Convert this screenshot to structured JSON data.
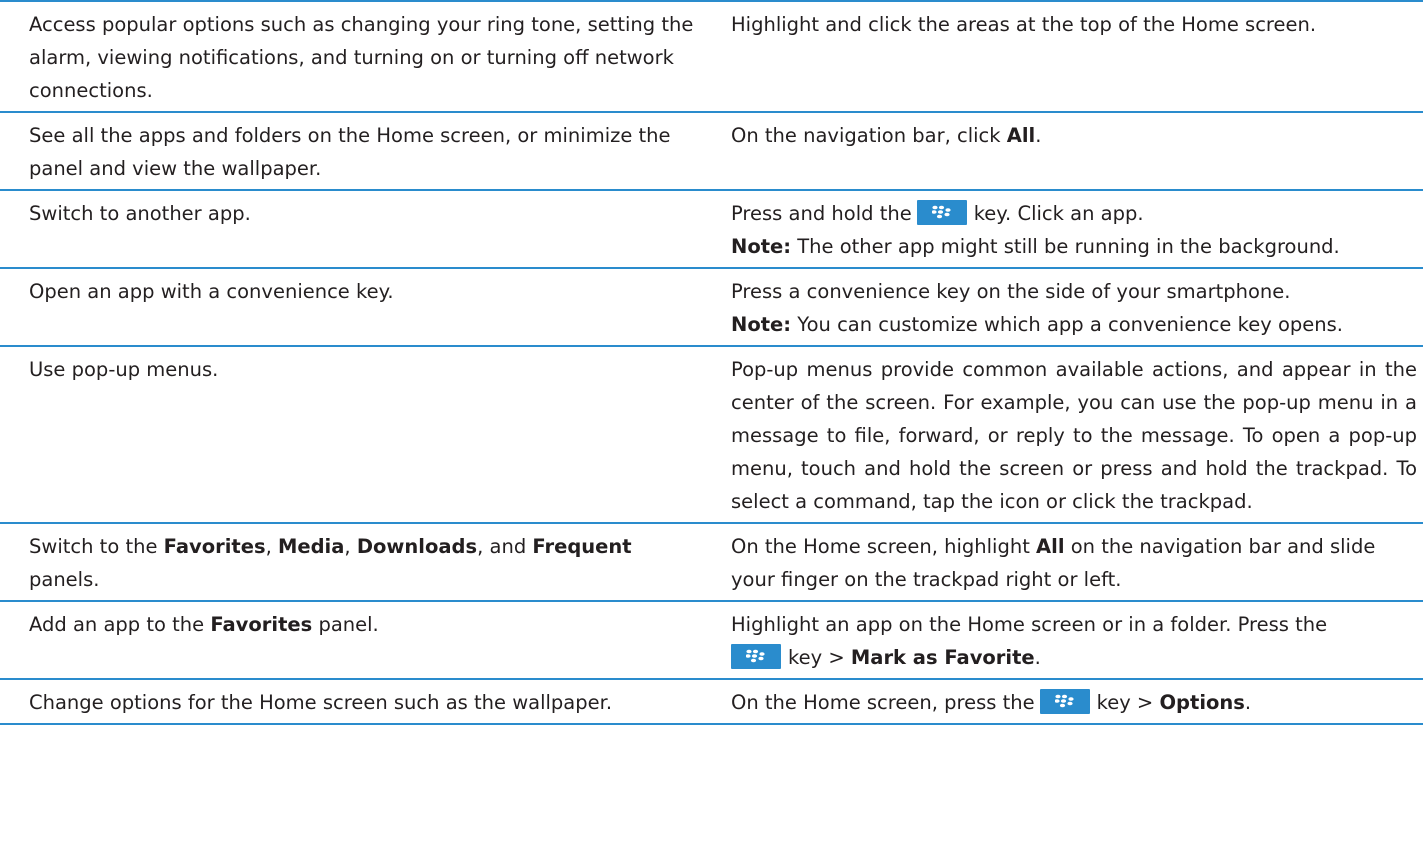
{
  "rows": [
    {
      "action": "Access popular options such as changing your ring tone, setting the alarm, viewing notifications, and turning on or turning off network connections.",
      "how": "Highlight and click the areas at the top of the Home screen."
    },
    {
      "action": "See all the apps and folders on the Home screen, or minimize the panel and view the wallpaper.",
      "how_pre": "On the navigation bar, click ",
      "how_bold": "All",
      "how_post": "."
    },
    {
      "action": "Switch to another app.",
      "how_pre": "Press and hold the",
      "how_post": "key. Click an app.",
      "note_label": "Note:",
      "note_text": " The other app might still be running in the background."
    },
    {
      "action": "Open an app with a convenience key.",
      "how": "Press a convenience key on the side of your smartphone.",
      "note_label": "Note:",
      "note_text": " You can customize which app a convenience key opens."
    },
    {
      "action": "Use pop-up menus.",
      "how": "Pop-up menus provide common available actions, and appear in the center of the screen. For example, you can use the pop-up menu in a message to file, forward, or reply to the message. To open a pop-up menu, touch and hold the screen or press and hold the trackpad. To select a command, tap the icon or click the trackpad."
    },
    {
      "action_pre": "Switch to the ",
      "action_b1": "Favorites",
      "action_s1": ", ",
      "action_b2": "Media",
      "action_s2": ", ",
      "action_b3": "Downloads",
      "action_s3": ", and ",
      "action_b4": "Frequent",
      "action_post": " panels.",
      "how_pre": "On the Home screen, highlight ",
      "how_bold": "All",
      "how_post": " on the navigation bar and slide your finger on the trackpad right or left."
    },
    {
      "action_pre": "Add an app to the ",
      "action_bold": "Favorites",
      "action_post": " panel.",
      "how_line1": "Highlight an app on the Home screen or in a folder. Press the",
      "how_mid": "key > ",
      "how_bold": "Mark as Favorite",
      "how_post": "."
    },
    {
      "action": "Change options for the Home screen such as the wallpaper.",
      "how_pre": "On the Home screen, press the",
      "how_mid": "key > ",
      "how_bold": "Options",
      "how_post": "."
    }
  ],
  "icons": {
    "menu_key": "blackberry-menu-key-icon",
    "key_color": "#2a8ccd",
    "border_color": "#2a8ccd"
  }
}
